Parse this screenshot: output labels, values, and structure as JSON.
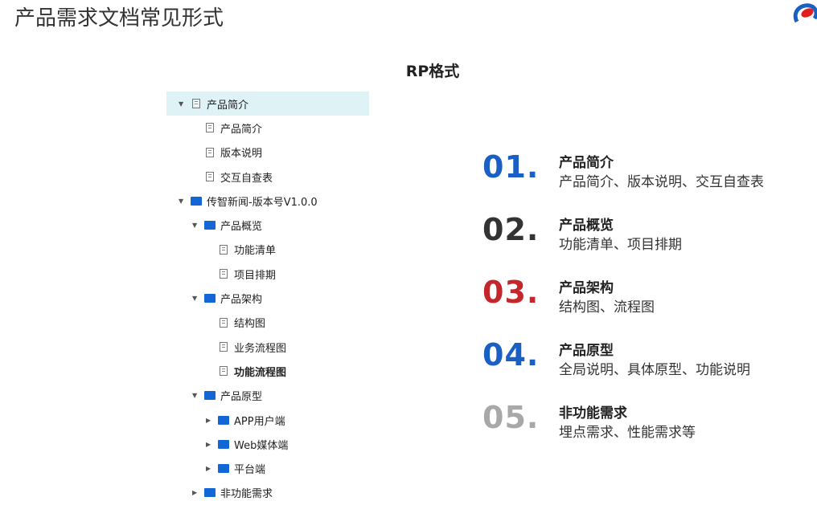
{
  "header": {
    "title": "产品需求文档常见形式",
    "logo": "brand-logo"
  },
  "subtitle": "RP格式",
  "tree": [
    {
      "label": "产品简介",
      "level": 0,
      "type": "page",
      "expanded": true,
      "selected": true
    },
    {
      "label": "产品简介",
      "level": 1,
      "type": "page"
    },
    {
      "label": "版本说明",
      "level": 1,
      "type": "page"
    },
    {
      "label": "交互自查表",
      "level": 1,
      "type": "page"
    },
    {
      "label": "传智新闻-版本号V1.0.0",
      "level": 0,
      "type": "folder",
      "expanded": true
    },
    {
      "label": "产品概览",
      "level": 1,
      "type": "folder",
      "expanded": true
    },
    {
      "label": "功能清单",
      "level": 2,
      "type": "page"
    },
    {
      "label": "项目排期",
      "level": 2,
      "type": "page"
    },
    {
      "label": "产品架构",
      "level": 1,
      "type": "folder",
      "expanded": true
    },
    {
      "label": "结构图",
      "level": 2,
      "type": "page"
    },
    {
      "label": "业务流程图",
      "level": 2,
      "type": "page"
    },
    {
      "label": "功能流程图",
      "level": 2,
      "type": "page",
      "bold": true
    },
    {
      "label": "产品原型",
      "level": 1,
      "type": "folder",
      "expanded": true
    },
    {
      "label": "APP用户端",
      "level": 2,
      "type": "folder",
      "expanded": false
    },
    {
      "label": "Web媒体端",
      "level": 2,
      "type": "folder",
      "expanded": false
    },
    {
      "label": "平台端",
      "level": 2,
      "type": "folder",
      "expanded": false
    },
    {
      "label": "非功能需求",
      "level": 1,
      "type": "folder",
      "expanded": false
    }
  ],
  "sections": [
    {
      "number": "01.",
      "title": "产品简介",
      "desc": "产品简介、版本说明、交互自查表",
      "color": "#1a5fc4"
    },
    {
      "number": "02.",
      "title": "产品概览",
      "desc": "功能清单、项目排期",
      "color": "#333333"
    },
    {
      "number": "03.",
      "title": "产品架构",
      "desc": "结构图、流程图",
      "color": "#c4262b"
    },
    {
      "number": "04.",
      "title": "产品原型",
      "desc": "全局说明、具体原型、功能说明",
      "color": "#1a5fc4"
    },
    {
      "number": "05.",
      "title": "非功能需求",
      "desc": "埋点需求、性能需求等",
      "color": "#a8a8a8"
    }
  ]
}
